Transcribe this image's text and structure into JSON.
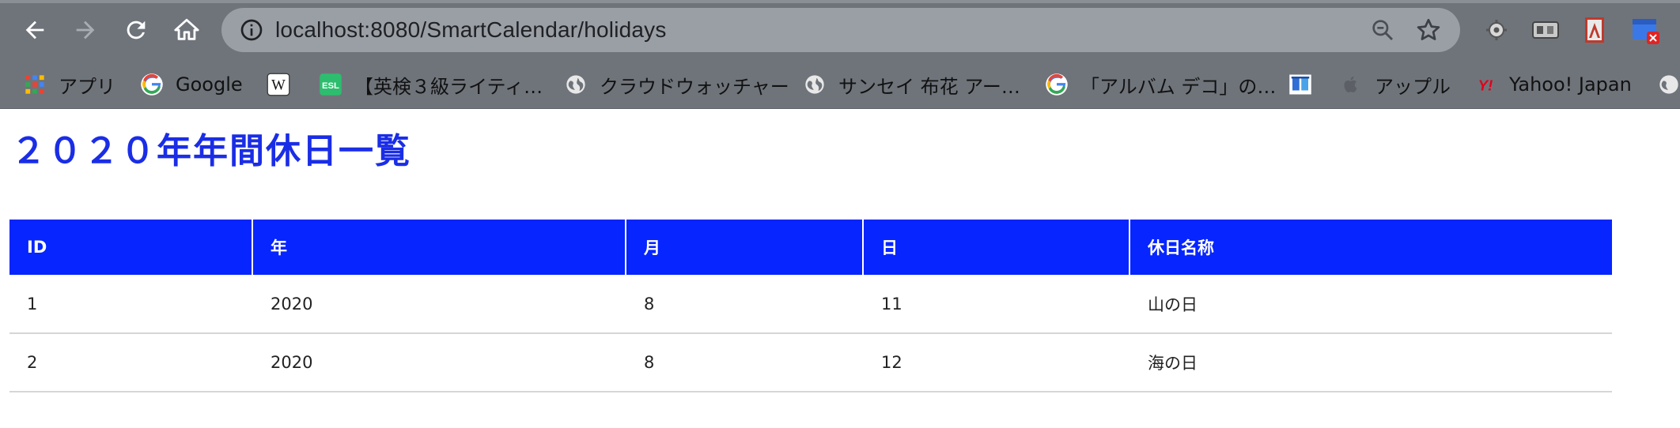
{
  "browser": {
    "url": "localhost:8080/SmartCalendar/holidays",
    "nav_icons": [
      "back-arrow-icon",
      "forward-arrow-icon",
      "reload-icon",
      "home-icon"
    ],
    "omnibox_icons": [
      "info-icon",
      "zoom-out-icon",
      "star-icon"
    ],
    "extension_icons": [
      "gear-extension-icon",
      "puzzle-extension-icon",
      "acrobat-extension-icon",
      "window-extension-icon"
    ]
  },
  "bookmarks": [
    {
      "label": "アプリ",
      "icon": "apps-grid-icon"
    },
    {
      "label": "Google",
      "icon": "google-icon"
    },
    {
      "label": "",
      "icon": "wikipedia-icon"
    },
    {
      "label": "【英検３級ライティ…",
      "icon": "esl-icon"
    },
    {
      "label": "クラウドウォッチャー",
      "icon": "globe-icon"
    },
    {
      "label": "サンセイ 布花 アー…",
      "icon": "globe-icon"
    },
    {
      "label": "「アルバム デコ」の…",
      "icon": "google-icon"
    },
    {
      "label": "",
      "icon": "book-icon"
    },
    {
      "label": "アップル",
      "icon": "apple-icon"
    },
    {
      "label": "Yahoo! Japan",
      "icon": "yahoo-icon"
    }
  ],
  "page": {
    "title": "２０２０年年間休日一覧",
    "table": {
      "headers": [
        "ID",
        "年",
        "月",
        "日",
        "休日名称"
      ],
      "rows": [
        [
          "1",
          "2020",
          "8",
          "11",
          "山の日"
        ],
        [
          "2",
          "2020",
          "8",
          "12",
          "海の日"
        ]
      ]
    }
  },
  "colors": {
    "title": "#1a2de6",
    "table_header_bg": "#0625ff",
    "toolbar_bg": "#6f747b"
  }
}
